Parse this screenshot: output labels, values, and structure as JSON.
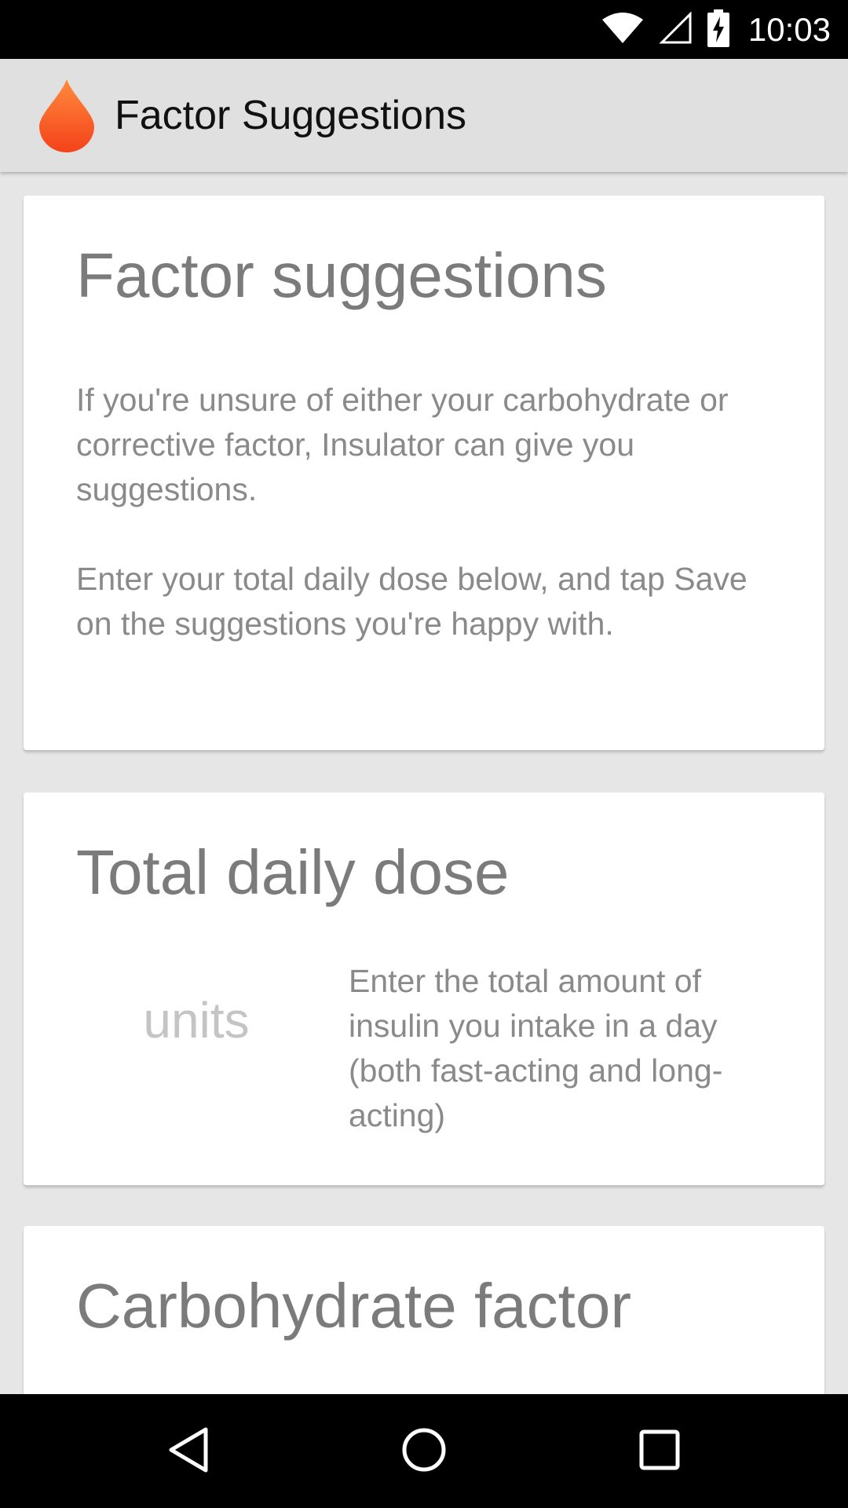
{
  "status_bar": {
    "time": "10:03",
    "icons": [
      "wifi-icon",
      "signal-icon",
      "battery-charging-icon"
    ]
  },
  "app_bar": {
    "title": "Factor Suggestions",
    "logo_icon": "blood-drop-icon",
    "logo_color": "#ff5722"
  },
  "intro_card": {
    "title": "Factor suggestions",
    "paragraph_1": "If you're unsure of either your carbohydrate or corrective factor, Insulator can give you suggestions.",
    "paragraph_2": "Enter your total daily dose below, and tap Save on the suggestions you're happy with."
  },
  "dose_card": {
    "title": "Total daily dose",
    "input_value": "",
    "input_placeholder": "units",
    "hint": "Enter the total amount of insulin you intake in a day (both fast-acting and long-acting)"
  },
  "carb_card": {
    "title": "Carbohydrate factor"
  },
  "nav_bar": {
    "buttons": [
      "back-icon",
      "home-icon",
      "recents-icon"
    ]
  }
}
